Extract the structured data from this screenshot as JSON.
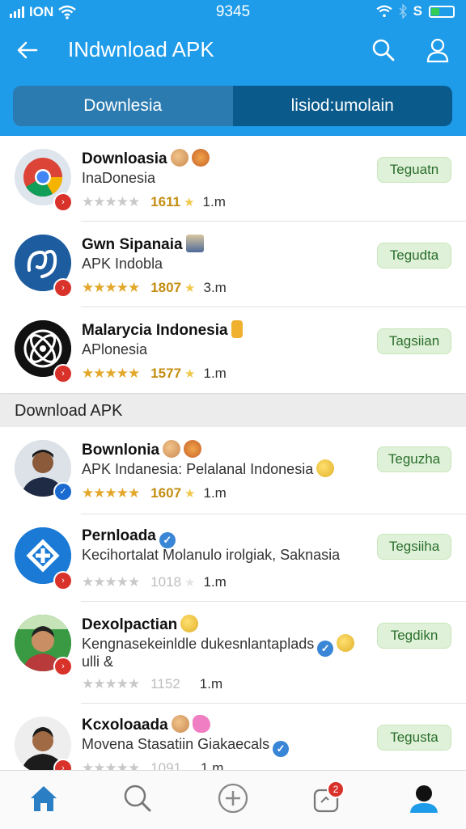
{
  "status": {
    "carrier": "ION",
    "time": "9345",
    "b_glyph": "S"
  },
  "appbar": {
    "title": "INdwnload APK"
  },
  "tabs": [
    {
      "label": "Downlesia"
    },
    {
      "label": "lisiod:umolain"
    }
  ],
  "section": {
    "title": "Download APK"
  },
  "top_apps": [
    {
      "name": "Downloasia",
      "sub": "InaDonesia",
      "rating": "1611",
      "size": "1.m",
      "button": "Teguatn"
    },
    {
      "name": "Gwn Sipanaia",
      "sub": "APK Indobla",
      "rating": "1807",
      "size": "3.m",
      "button": "Tegudta"
    },
    {
      "name": "Malarycia Indonesia",
      "sub": "APlonesia",
      "rating": "1577",
      "size": "1.m",
      "button": "Tagsiian"
    }
  ],
  "list_apps": [
    {
      "name": "Bownlonia",
      "sub": "APK Indanesia: Pelalanal Indonesia",
      "rating": "1607",
      "size": "1.m",
      "button": "Teguzha"
    },
    {
      "name": "Pernloada",
      "sub": "Kecihortalat Molanulo irolgiak, Saknasia",
      "rating": "1018",
      "size": "1.m",
      "button": "Tegsiiha"
    },
    {
      "name": "Dexolpactian",
      "sub": "Kengnasekeinldle dukesnlantaplads",
      "sub2": "ulli &",
      "rating": "1152",
      "size": "1.m",
      "button": "Tegdikn"
    },
    {
      "name": "Kcxoloaada",
      "sub": "Movena Stasatiin Giakaecals",
      "rating": "1091",
      "size": "1.m",
      "button": "Tegusta"
    }
  ],
  "nav_badge": "2",
  "colors": {
    "primary": "#1e9be9",
    "tab_active": "#0a5a8c",
    "button_bg": "#dff1d8",
    "rating_gold": "#c48e12"
  }
}
